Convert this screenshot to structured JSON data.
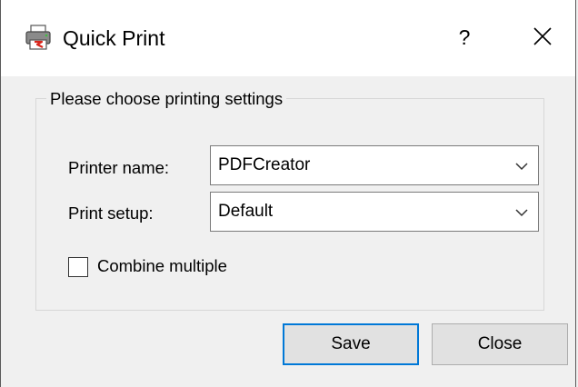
{
  "window": {
    "title": "Quick Print",
    "help_label": "?"
  },
  "group": {
    "legend": "Please choose printing settings"
  },
  "printer": {
    "label": "Printer name:",
    "value": "PDFCreator"
  },
  "setup": {
    "label": "Print setup:",
    "value": "Default"
  },
  "combine": {
    "label": "Combine multiple",
    "checked": false
  },
  "buttons": {
    "save_label": "Save",
    "close_label": "Close"
  },
  "colors": {
    "accent": "#0078d7",
    "icon_red": "#d9261c"
  },
  "icons": {
    "app": "printer-icon",
    "close": "close-icon",
    "dropdown": "chevron-down-icon"
  }
}
